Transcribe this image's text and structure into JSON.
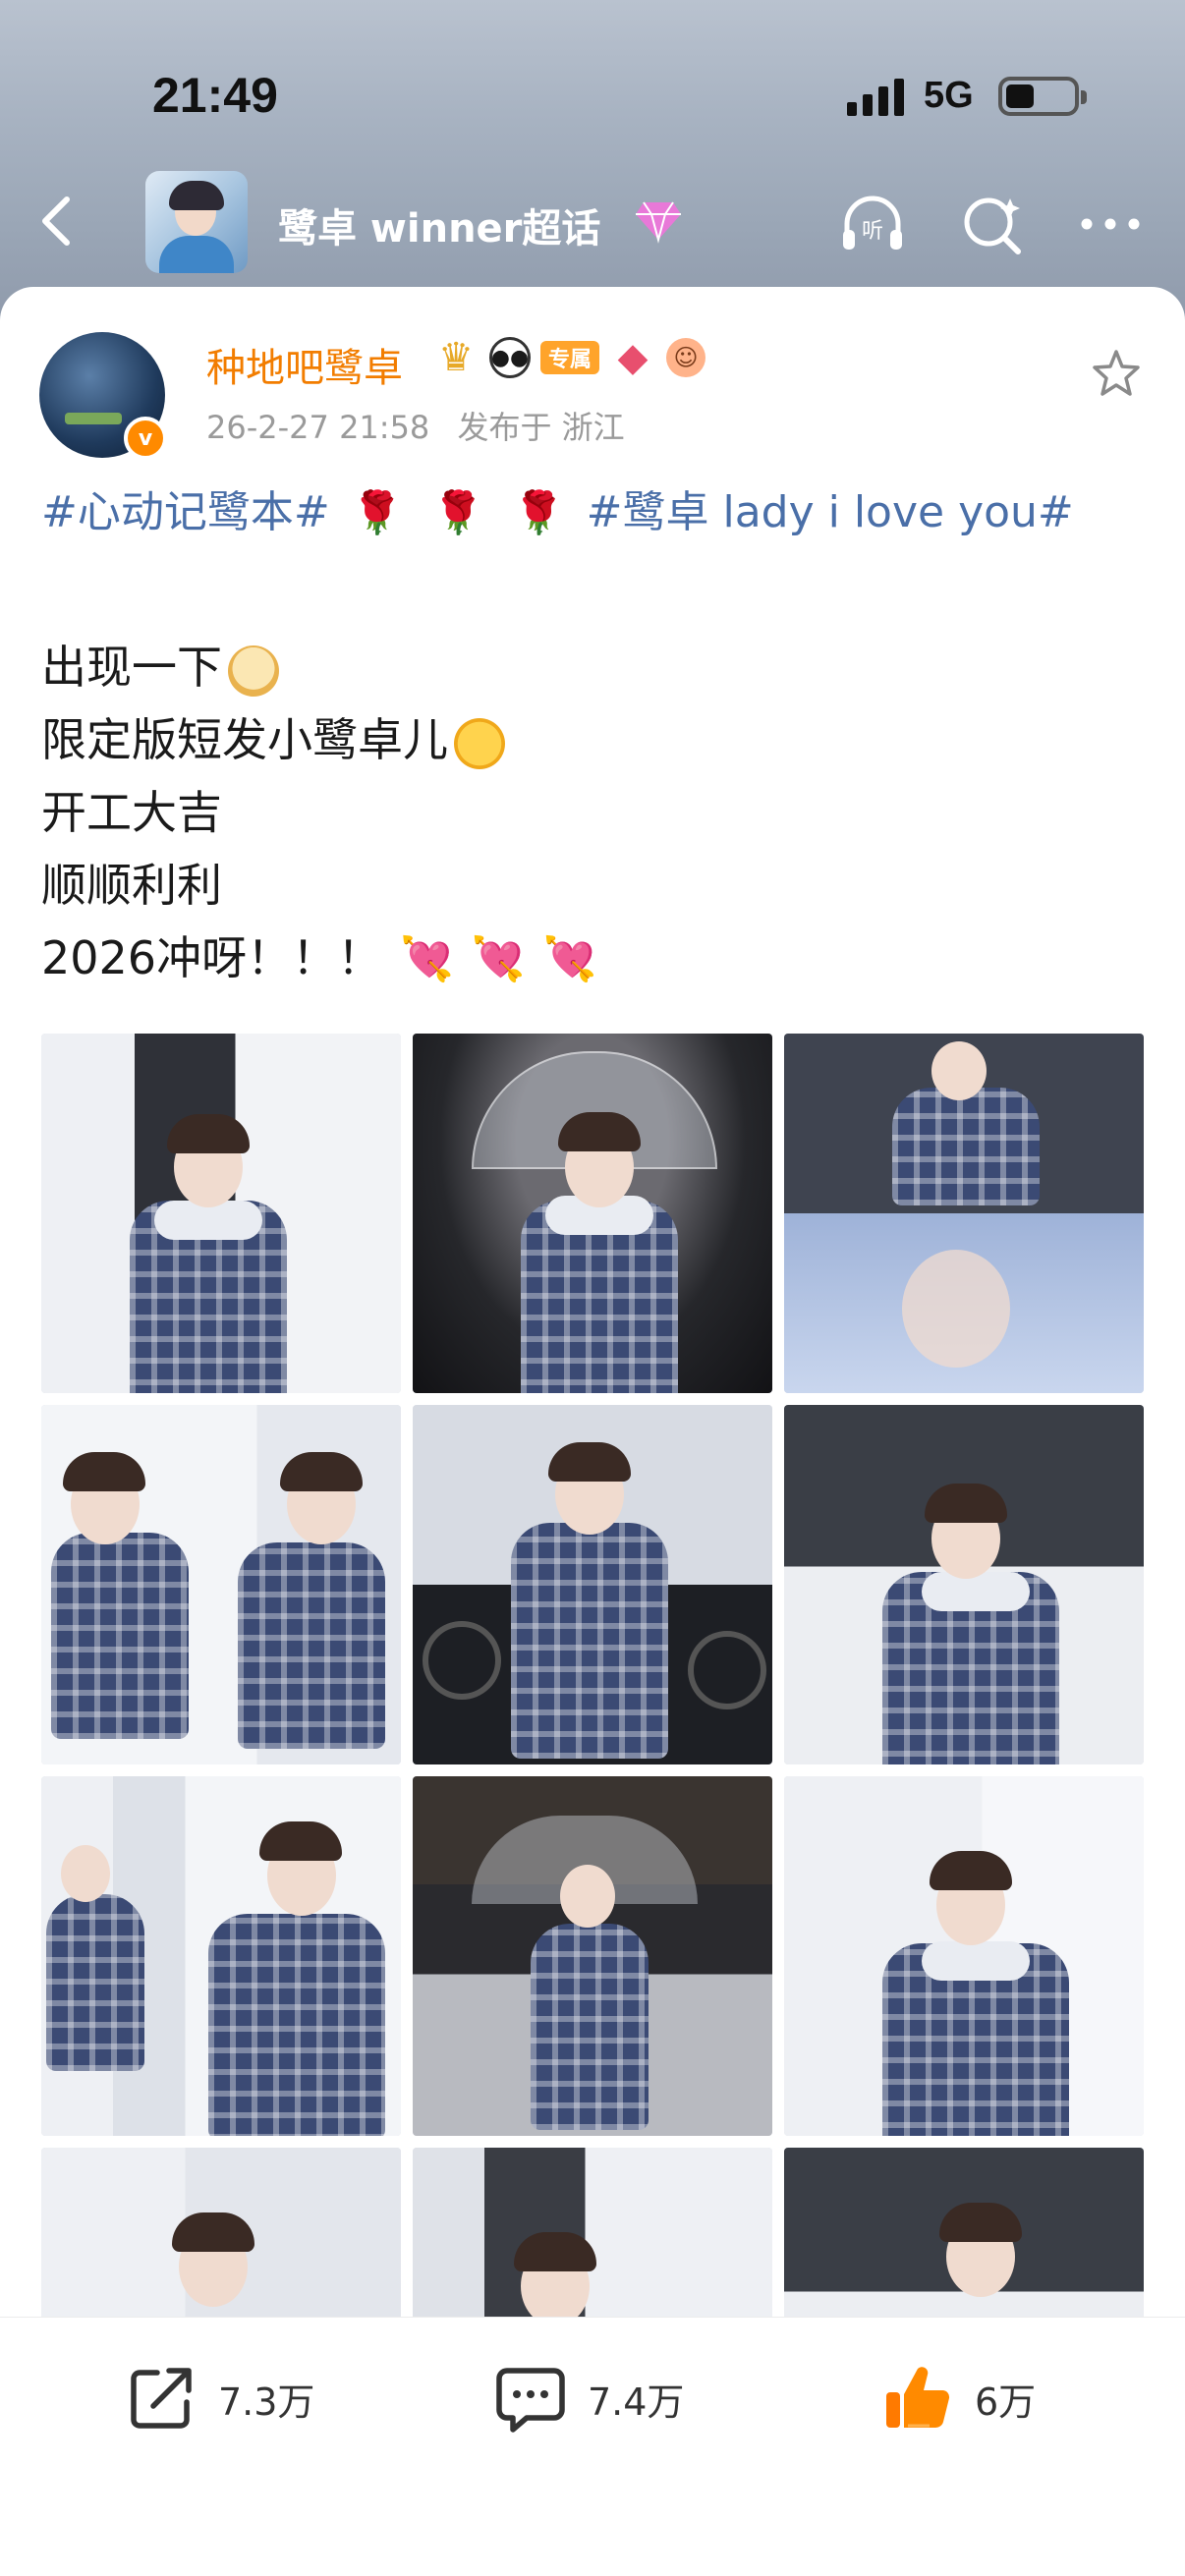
{
  "status_bar": {
    "time": "21:49",
    "network": "5G"
  },
  "nav": {
    "topic_title": "鹭卓 winner超话"
  },
  "post": {
    "username": "种地吧鹭卓",
    "badge_special": "专属",
    "date": "26-2-27 21:58",
    "location": "发布于 浙江",
    "hashtag_1": "#心动记鹭本#",
    "hashtag_2": "#鹭卓 lady i love you#",
    "rose": "🌹",
    "lines": [
      "出现一下",
      "限定版短发小鹭卓儿",
      "开工大吉",
      "顺顺利利",
      "2026冲呀！！！"
    ],
    "hearts": "💘💘💘"
  },
  "actions": {
    "share_count": "7.3万",
    "comment_count": "7.4万",
    "like_count": "6万"
  },
  "colors": {
    "username": "#f27d00",
    "hashtag": "#4a6fa8",
    "like": "#ff8a00"
  }
}
